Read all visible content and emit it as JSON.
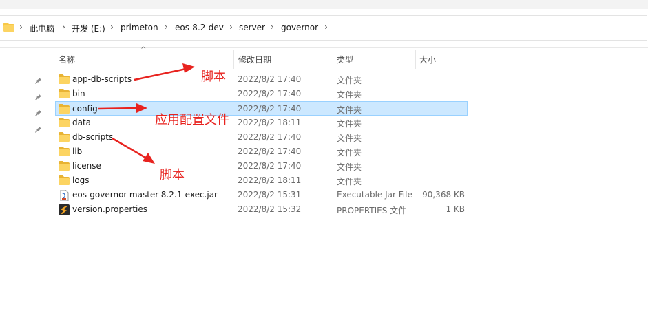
{
  "breadcrumb": {
    "items": [
      "此电脑",
      "开发 (E:)",
      "primeton",
      "eos-8.2-dev",
      "server",
      "governor"
    ]
  },
  "columns": {
    "name": "名称",
    "date": "修改日期",
    "type": "类型",
    "size": "大小"
  },
  "files": [
    {
      "name": "app-db-scripts",
      "date": "2022/8/2 17:40",
      "type": "文件夹",
      "size": "",
      "icon": "folder-icon"
    },
    {
      "name": "bin",
      "date": "2022/8/2 17:40",
      "type": "文件夹",
      "size": "",
      "icon": "folder-icon"
    },
    {
      "name": "config",
      "date": "2022/8/2 17:40",
      "type": "文件夹",
      "size": "",
      "icon": "folder-icon"
    },
    {
      "name": "data",
      "date": "2022/8/2 18:11",
      "type": "文件夹",
      "size": "",
      "icon": "folder-icon"
    },
    {
      "name": "db-scripts",
      "date": "2022/8/2 17:40",
      "type": "文件夹",
      "size": "",
      "icon": "folder-icon"
    },
    {
      "name": "lib",
      "date": "2022/8/2 17:40",
      "type": "文件夹",
      "size": "",
      "icon": "folder-icon"
    },
    {
      "name": "license",
      "date": "2022/8/2 17:40",
      "type": "文件夹",
      "size": "",
      "icon": "folder-icon"
    },
    {
      "name": "logs",
      "date": "2022/8/2 18:11",
      "type": "文件夹",
      "size": "",
      "icon": "folder-icon"
    },
    {
      "name": "eos-governor-master-8.2.1-exec.jar",
      "date": "2022/8/2 15:31",
      "type": "Executable Jar File",
      "size": "90,368 KB",
      "icon": "jar-file-icon"
    },
    {
      "name": "version.properties",
      "date": "2022/8/2 15:32",
      "type": "PROPERTIES 文件",
      "size": "1 KB",
      "icon": "properties-file-icon"
    }
  ],
  "selected_row": "config",
  "annotations": {
    "script1": "脚本",
    "config": "应用配置文件",
    "script2": "脚本"
  },
  "colors": {
    "annotation": "#e8231f",
    "selection_bg": "#cce8ff",
    "selection_border": "#99d1ff",
    "folder": "#f8c847"
  }
}
